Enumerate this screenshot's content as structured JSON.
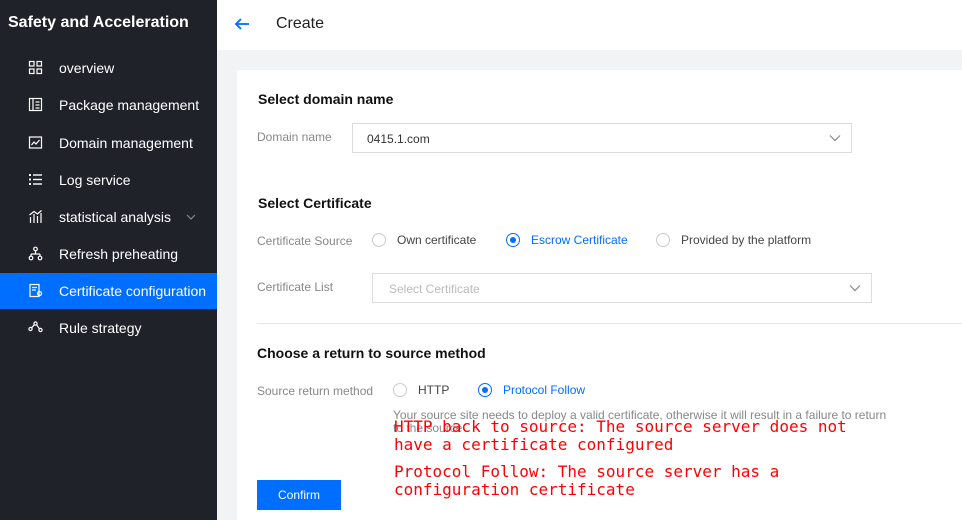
{
  "sidebar": {
    "title": "Safety and Acceleration",
    "items": [
      {
        "label": "overview",
        "icon": "grid-icon"
      },
      {
        "label": "Package management",
        "icon": "package-icon"
      },
      {
        "label": "Domain management",
        "icon": "domain-icon"
      },
      {
        "label": "Log service",
        "icon": "list-icon"
      },
      {
        "label": "statistical analysis",
        "icon": "chart-icon",
        "expandable": true
      },
      {
        "label": "Refresh preheating",
        "icon": "refresh-icon"
      },
      {
        "label": "Certificate configuration",
        "icon": "certificate-icon",
        "active": true
      },
      {
        "label": "Rule strategy",
        "icon": "rule-icon"
      }
    ]
  },
  "header": {
    "title": "Create"
  },
  "domain_section": {
    "title": "Select domain name",
    "label": "Domain name",
    "value": "0415.1.com"
  },
  "certificate_section": {
    "title": "Select Certificate",
    "source_label": "Certificate Source",
    "source_options": [
      {
        "label": "Own certificate",
        "checked": false
      },
      {
        "label": "Escrow Certificate",
        "checked": true
      },
      {
        "label": "Provided by the platform",
        "checked": false
      }
    ],
    "list_label": "Certificate List",
    "list_placeholder": "Select Certificate"
  },
  "return_section": {
    "title": "Choose a return to source method",
    "method_label": "Source return method",
    "options": [
      {
        "label": "HTTP",
        "checked": false
      },
      {
        "label": "Protocol Follow",
        "checked": true
      }
    ],
    "hint_line1": "Your source site needs to deploy a valid certificate, otherwise it will result in a failure to return",
    "hint_line2": "to the source"
  },
  "annotations": {
    "line1": "HTTP back to source: The source server does not",
    "line2": "have a certificate configured",
    "line3": "Protocol Follow: The source server has a",
    "line4": "configuration certificate"
  },
  "actions": {
    "confirm_label": "Confirm"
  },
  "colors": {
    "sidebar_bg": "#1f2329",
    "accent": "#006eff",
    "annotation": "#ff0000"
  }
}
